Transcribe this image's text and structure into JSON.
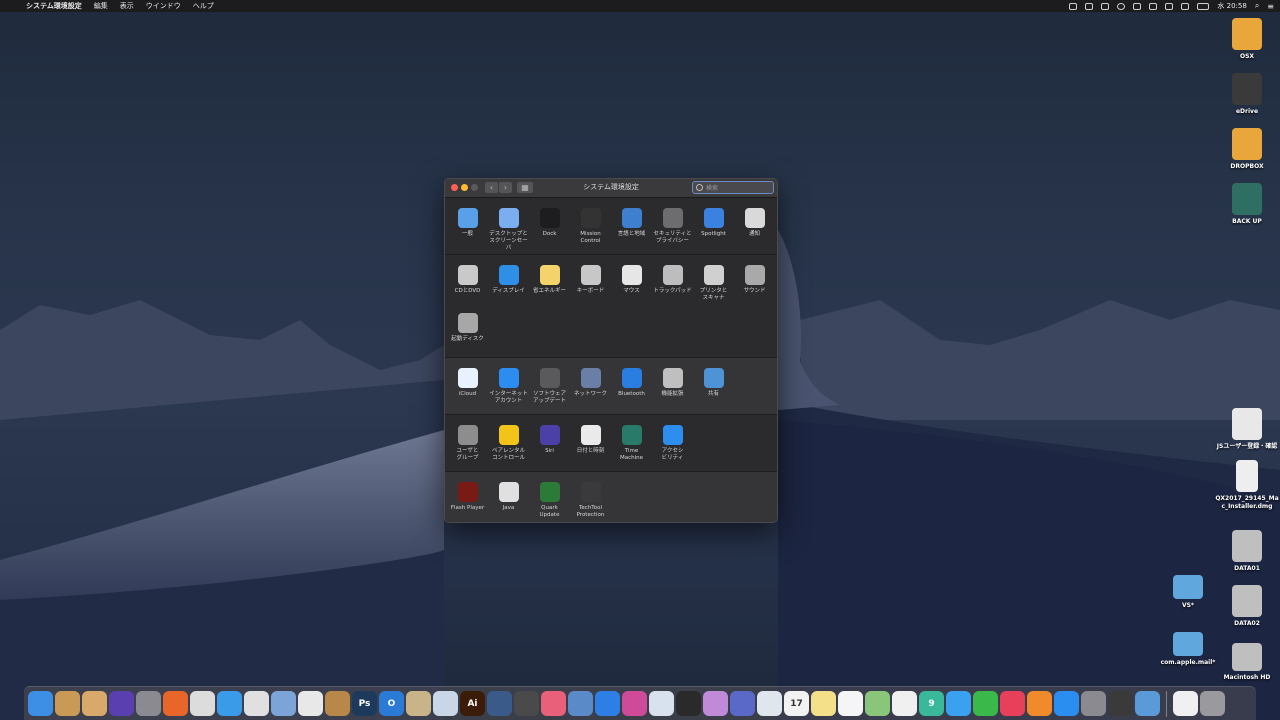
{
  "menubar": {
    "app_name": "システム環境設定",
    "items": [
      "編集",
      "表示",
      "ウインドウ",
      "ヘルプ"
    ],
    "clock": "水 20:58"
  },
  "window": {
    "title": "システム環境設定",
    "search_placeholder": "検索",
    "sections": [
      [
        {
          "label": "一般",
          "icon": "general-icon",
          "color": "#5aa0e8"
        },
        {
          "label": "デスクトップと\nスクリーンセーバ",
          "icon": "desktop-icon",
          "color": "#7aaef0"
        },
        {
          "label": "Dock",
          "icon": "dock-icon",
          "color": "#1d1d1f"
        },
        {
          "label": "Mission\nControl",
          "icon": "mission-control-icon",
          "color": "#333"
        },
        {
          "label": "言語と地域",
          "icon": "flag-icon",
          "color": "#3f7fd0"
        },
        {
          "label": "セキュリティと\nプライバシー",
          "icon": "house-icon",
          "color": "#6d6d70"
        },
        {
          "label": "Spotlight",
          "icon": "spotlight-icon",
          "color": "#3b82e0"
        },
        {
          "label": "通知",
          "icon": "notifications-icon",
          "color": "#d9d9d9"
        }
      ],
      [
        {
          "label": "CDとDVD",
          "icon": "cd-icon",
          "color": "#c9c9c9"
        },
        {
          "label": "ディスプレイ",
          "icon": "display-icon",
          "color": "#2f8ee6"
        },
        {
          "label": "省エネルギー",
          "icon": "bulb-icon",
          "color": "#f3d36a"
        },
        {
          "label": "キーボード",
          "icon": "keyboard-icon",
          "color": "#c7c7c7"
        },
        {
          "label": "マウス",
          "icon": "mouse-icon",
          "color": "#e6e6e6"
        },
        {
          "label": "トラックパッド",
          "icon": "trackpad-icon",
          "color": "#bdbdbd"
        },
        {
          "label": "プリンタと\nスキャナ",
          "icon": "printer-icon",
          "color": "#d0d0d0"
        },
        {
          "label": "サウンド",
          "icon": "speaker-icon",
          "color": "#a9a9a9"
        },
        {
          "label": "起動ディスク",
          "icon": "disk-icon",
          "color": "#a7a7a7"
        }
      ],
      [
        {
          "label": "iCloud",
          "icon": "icloud-icon",
          "color": "#e8f2fc"
        },
        {
          "label": "インターネット\nアカウント",
          "icon": "at-icon",
          "color": "#2d8cf0"
        },
        {
          "label": "ソフトウェア\nアップデート",
          "icon": "gear-icon",
          "color": "#5a5a5d"
        },
        {
          "label": "ネットワーク",
          "icon": "globe-icon",
          "color": "#6a7fa6"
        },
        {
          "label": "Bluetooth",
          "icon": "bluetooth-icon",
          "color": "#2a7de1"
        },
        {
          "label": "機能拡張",
          "icon": "puzzle-icon",
          "color": "#bfbfbf"
        },
        {
          "label": "共有",
          "icon": "sharing-icon",
          "color": "#4d93d6"
        }
      ],
      [
        {
          "label": "ユーザと\nグループ",
          "icon": "users-icon",
          "color": "#8d8d8d"
        },
        {
          "label": "ペアレンタル\nコントロール",
          "icon": "parental-icon",
          "color": "#f2c319"
        },
        {
          "label": "Siri",
          "icon": "siri-icon",
          "color": "#4b3fa8"
        },
        {
          "label": "日付と時刻",
          "icon": "clock-icon",
          "color": "#eaeaea"
        },
        {
          "label": "Time\nMachine",
          "icon": "time-machine-icon",
          "color": "#2a7a6a"
        },
        {
          "label": "アクセシ\nビリティ",
          "icon": "accessibility-icon",
          "color": "#2e8ef0"
        }
      ],
      [
        {
          "label": "Flash Player",
          "icon": "flash-icon",
          "color": "#7a1a14"
        },
        {
          "label": "Java",
          "icon": "java-icon",
          "color": "#e0e0e0"
        },
        {
          "label": "Quark\nUpdate",
          "icon": "quark-icon",
          "color": "#2c7a38"
        },
        {
          "label": "TechTool\nProtection",
          "icon": "techtool-icon",
          "color": "#3a3a3c"
        }
      ]
    ]
  },
  "desktop_icons": [
    {
      "label": "OSX",
      "color": "#e9a63a"
    },
    {
      "label": "eDrive",
      "color": "#3a3a3a"
    },
    {
      "label": "DROPBOX",
      "color": "#e9a63a"
    },
    {
      "label": "BACK UP",
      "color": "#2f6e62"
    },
    {
      "label": "JSユーザー登録・確認",
      "color": "#e8e8e8"
    },
    {
      "label": "QX2017_29145_Ma\nc_Installer.dmg",
      "color": "#eeeeee"
    },
    {
      "label": "DATA01",
      "color": "#bfbfbf"
    },
    {
      "label": "DATA02",
      "color": "#bfbfbf"
    },
    {
      "label": "Macintosh HD",
      "color": "#bfbfbf"
    },
    {
      "label": "VS*",
      "color": "#5fa7dc"
    },
    {
      "label": "com.apple.mail*",
      "color": "#5fa7dc"
    }
  ],
  "dock": [
    {
      "name": "finder",
      "color": "#3d8fe6"
    },
    {
      "name": "package",
      "color": "#c89a55"
    },
    {
      "name": "archive",
      "color": "#d9a96b"
    },
    {
      "name": "siri",
      "color": "#5a3fb0"
    },
    {
      "name": "launchpad",
      "color": "#8a8a90"
    },
    {
      "name": "firefox",
      "color": "#e8662a"
    },
    {
      "name": "chrome",
      "color": "#dcdcdc"
    },
    {
      "name": "safari",
      "color": "#3a9be8"
    },
    {
      "name": "script",
      "color": "#e0e0e0"
    },
    {
      "name": "preview",
      "color": "#7ca4d8"
    },
    {
      "name": "textedit",
      "color": "#e8e8e8"
    },
    {
      "name": "books",
      "color": "#b8874a"
    },
    {
      "name": "photoshop",
      "color": "#1d3a5c",
      "text": "Ps"
    },
    {
      "name": "outlook",
      "color": "#2a7ad6",
      "text": "O"
    },
    {
      "name": "installer",
      "color": "#c9b48a"
    },
    {
      "name": "pen",
      "color": "#c8d6e8"
    },
    {
      "name": "illustrator",
      "color": "#3b1c08",
      "text": "Ai"
    },
    {
      "name": "network",
      "color": "#3a5a8a"
    },
    {
      "name": "techtool",
      "color": "#4a4a4a"
    },
    {
      "name": "flamingo",
      "color": "#e8607a"
    },
    {
      "name": "bird",
      "color": "#5a8ac8"
    },
    {
      "name": "dropbox",
      "color": "#2d7fe6"
    },
    {
      "name": "player",
      "color": "#d04a9a"
    },
    {
      "name": "bag",
      "color": "#d8e2ee"
    },
    {
      "name": "clapper",
      "color": "#2a2a2a"
    },
    {
      "name": "finalcut",
      "color": "#c08ad8"
    },
    {
      "name": "paint",
      "color": "#5a68c8"
    },
    {
      "name": "mail",
      "color": "#dfe6ee"
    },
    {
      "name": "calendar",
      "color": "#f2f2f2",
      "text": "17"
    },
    {
      "name": "notes",
      "color": "#f5e08a"
    },
    {
      "name": "reminders",
      "color": "#f5f5f5"
    },
    {
      "name": "maps",
      "color": "#8ac67a"
    },
    {
      "name": "photos",
      "color": "#f0f0f0"
    },
    {
      "name": "app9",
      "color": "#3ab89a",
      "text": "9"
    },
    {
      "name": "messages",
      "color": "#3aa0f0"
    },
    {
      "name": "facetime",
      "color": "#3ab84a"
    },
    {
      "name": "music",
      "color": "#e8405a"
    },
    {
      "name": "ibooks",
      "color": "#f08a2a"
    },
    {
      "name": "appstore",
      "color": "#2a8ef0"
    },
    {
      "name": "sysprefs",
      "color": "#8a8a90"
    },
    {
      "name": "timemachine",
      "color": "#3a3a3a"
    },
    {
      "name": "globe",
      "color": "#5a9ad8"
    },
    {
      "name": "document",
      "color": "#f0f0f0"
    },
    {
      "name": "trash",
      "color": "#9a9a9e"
    }
  ]
}
